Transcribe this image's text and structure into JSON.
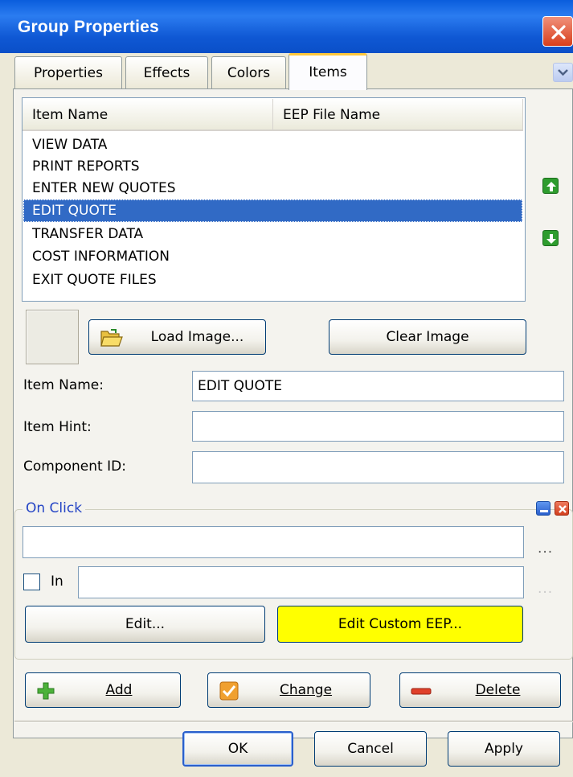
{
  "window": {
    "title": "Group Properties"
  },
  "tabs": [
    {
      "label": "Properties"
    },
    {
      "label": "Effects"
    },
    {
      "label": "Colors"
    },
    {
      "label": "Items"
    }
  ],
  "active_tab": "Items",
  "list": {
    "columns": [
      "Item Name",
      "EEP File Name"
    ],
    "items": [
      "VIEW DATA",
      "PRINT REPORTS",
      "ENTER NEW QUOTES",
      "EDIT QUOTE",
      "TRANSFER DATA",
      "COST INFORMATION",
      "EXIT QUOTE FILES"
    ],
    "selected_index": 3
  },
  "image_buttons": {
    "load": "Load Image...",
    "clear": "Clear Image"
  },
  "form": {
    "item_name_label": "Item Name:",
    "item_name_value": "EDIT QUOTE",
    "item_hint_label": "Item Hint:",
    "item_hint_value": "",
    "component_id_label": "Component ID:",
    "component_id_value": ""
  },
  "on_click": {
    "title": "On Click",
    "action_value": "",
    "in_label": "In",
    "in_value": "",
    "in_checked": false,
    "browse_label": "...",
    "edit_button": "Edit...",
    "edit_custom_button": "Edit Custom EEP...",
    "edit_custom_color": "#ffff00"
  },
  "item_buttons": {
    "add": "Add",
    "change": "Change",
    "delete": "Delete"
  },
  "dialog_buttons": {
    "ok": "OK",
    "cancel": "Cancel",
    "apply": "Apply"
  },
  "icons": {
    "close": "close-icon",
    "move_up": "arrow-up-icon",
    "move_down": "arrow-down-icon",
    "load_image": "folder-open-icon",
    "add": "plus-icon",
    "change": "checkmark-icon",
    "delete": "minus-icon",
    "collapse": "minus-box-icon",
    "clear": "close-box-icon"
  },
  "colors": {
    "titlebar": "#0a5ddc",
    "selection": "#316ac5",
    "group_title": "#2545c5",
    "edit_custom": "#ffff00"
  }
}
